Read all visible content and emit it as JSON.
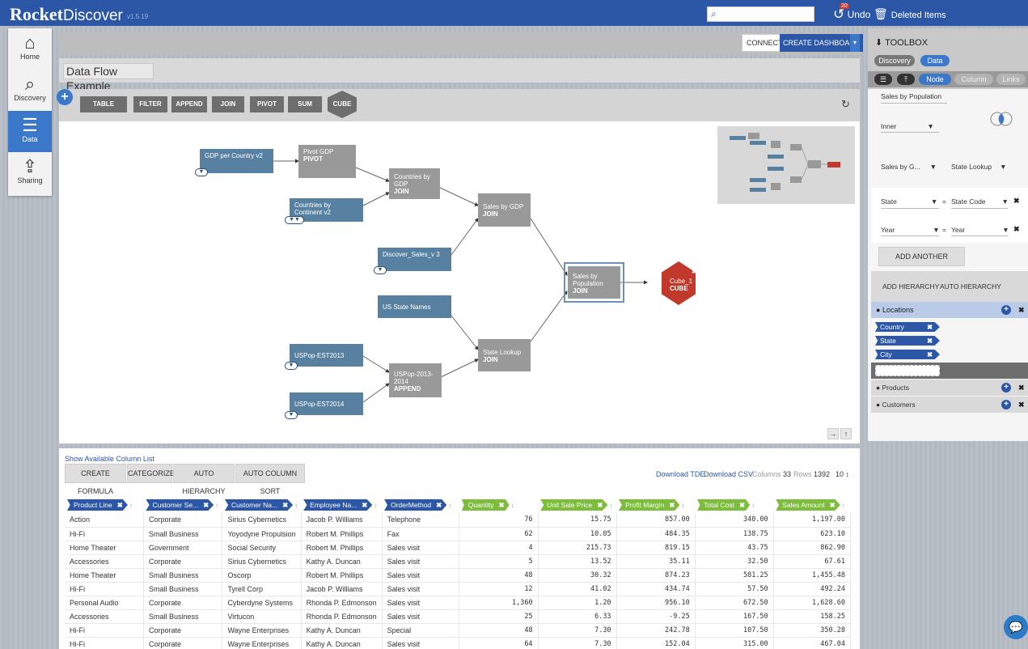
{
  "app": {
    "logo_brand": "Rocket",
    "logo_product": "Discover",
    "version": "v1.5.19"
  },
  "header": {
    "search_placeholder": "",
    "undo_label": "Undo",
    "undo_count": "20",
    "deleted_label": "Deleted Items"
  },
  "leftnav": [
    {
      "label": "Home",
      "icon": "home-icon"
    },
    {
      "label": "Discovery",
      "icon": "search-icon"
    },
    {
      "label": "Data",
      "icon": "database-icon"
    },
    {
      "label": "Sharing",
      "icon": "share-icon"
    }
  ],
  "actions": {
    "connect": "CONNECT",
    "create_dashboard": "CREATE DASHBOARD"
  },
  "flow_title": "Data Flow Example",
  "tools": [
    "TABLE",
    "FILTER",
    "APPEND",
    "JOIN",
    "PIVOT",
    "SUM",
    "CUBE"
  ],
  "nodes": {
    "gdp": "GDP per Country v2",
    "pivot_gdp": "Pivot GDP",
    "pivot_op": "PIVOT",
    "countries_by_gdp": "Countries by GDP",
    "join_op": "JOIN",
    "countries_by_continent": "Countries by Continent v2",
    "sales_by_gdp": "Sales by GDP",
    "discover_sales": "Discover_Sales_v 3",
    "sales_by_population": "Sales by Population",
    "cube1": "Cube_1",
    "cube_op": "CUBE",
    "us_state_names": "US State Names",
    "state_lookup": "State Lookup",
    "uspop2013": "USPop-EST2013",
    "uspop_append": "USPop-2013-2014",
    "append_op": "APPEND",
    "uspop2014": "USPop-EST2014"
  },
  "table_panel": {
    "show_columns": "Show Available Column List",
    "create_formula": "CREATE FORMULA",
    "categorize": "CATEGORIZE",
    "auto_hierarchy": "AUTO HIERARCHY",
    "auto_column_sort": "AUTO COLUMN SORT",
    "download_tde": "Download TDE",
    "download_csv": "Download CSV",
    "columns_label": "Columns",
    "columns_value": "33",
    "rows_label": "Rows",
    "rows_value": "1392",
    "page_size": "10"
  },
  "columns": [
    {
      "label": "Product Line",
      "color": "b"
    },
    {
      "label": "Customer Se...",
      "color": "b"
    },
    {
      "label": "Customer Na...",
      "color": "b"
    },
    {
      "label": "Employee Na...",
      "color": "b"
    },
    {
      "label": "OrderMethod",
      "color": "b"
    },
    {
      "label": "Quantity",
      "color": "g"
    },
    {
      "label": "Unit Sale Price",
      "color": "g"
    },
    {
      "label": "Profit Margin",
      "color": "g"
    },
    {
      "label": "Total Cost",
      "color": "g"
    },
    {
      "label": "Sales Amount",
      "color": "g"
    }
  ],
  "rows": [
    [
      "Action",
      "Corporate",
      "Sirius Cybernetics",
      "Jacob P. Williams",
      "Telephone",
      "76",
      "15.75",
      "857.00",
      "340.00",
      "1,197.00"
    ],
    [
      "Hi-Fi",
      "Small Business",
      "Yoyodyne Propulsion",
      "Robert M. Phillips",
      "Fax",
      "62",
      "10.05",
      "484.35",
      "138.75",
      "623.10"
    ],
    [
      "Home Theater",
      "Government",
      "Social Security",
      "Robert M. Phillips",
      "Sales visit",
      "4",
      "215.73",
      "819.15",
      "43.75",
      "862.90"
    ],
    [
      "Accessories",
      "Corporate",
      "Sirius Cybernetics",
      "Kathy A. Duncan",
      "Sales visit",
      "5",
      "13.52",
      "35.11",
      "32.50",
      "67.61"
    ],
    [
      "Home Theater",
      "Small Business",
      "Oscorp",
      "Robert M. Phillips",
      "Sales visit",
      "48",
      "30.32",
      "874.23",
      "581.25",
      "1,455.48"
    ],
    [
      "Hi-Fi",
      "Small Business",
      "Tyrell Corp",
      "Jacob P. Williams",
      "Sales visit",
      "12",
      "41.02",
      "434.74",
      "57.50",
      "492.24"
    ],
    [
      "Personal Audio",
      "Corporate",
      "Cyberdyne Systems",
      "Rhonda P. Edmonson",
      "Sales visit",
      "1,360",
      "1.20",
      "956.10",
      "672.50",
      "1,628.60"
    ],
    [
      "Accessories",
      "Small Business",
      "Virtucon",
      "Rhonda P. Edmonson",
      "Sales visit",
      "25",
      "6.33",
      "-9.25",
      "167.50",
      "158.25"
    ],
    [
      "Hi-Fi",
      "Corporate",
      "Wayne Enterprises",
      "Kathy A. Duncan",
      "Special",
      "48",
      "7.30",
      "242.78",
      "107.50",
      "350.28"
    ],
    [
      "Hi-Fi",
      "Corporate",
      "Wayne Enterprises",
      "Kathy A. Duncan",
      "Sales visit",
      "64",
      "7.30",
      "152.04",
      "315.00",
      "467.04"
    ]
  ],
  "toolbox": {
    "title": "TOOLBOX",
    "tab_discovery": "Discovery",
    "tab_data": "Data",
    "tab_node": "Node",
    "tab_column": "Column",
    "tab_links": "Links",
    "node_name": "Sales by Population",
    "join_type": "Inner",
    "left_source": "Sales by G...",
    "right_source": "State Lookup",
    "cond1_left": "State",
    "cond1_right": "State Code",
    "cond2_left": "Year",
    "cond2_right": "Year",
    "eq": "=",
    "add_condition": "ADD ANOTHER CONDITION",
    "add_hierarchy": "ADD HIERARCHY",
    "auto_hierarchy": "AUTO HIERARCHY",
    "hier_locations": "Locations",
    "hier_items": [
      "Country",
      "State",
      "City"
    ],
    "hier_products": "Products",
    "hier_customers": "Customers"
  }
}
